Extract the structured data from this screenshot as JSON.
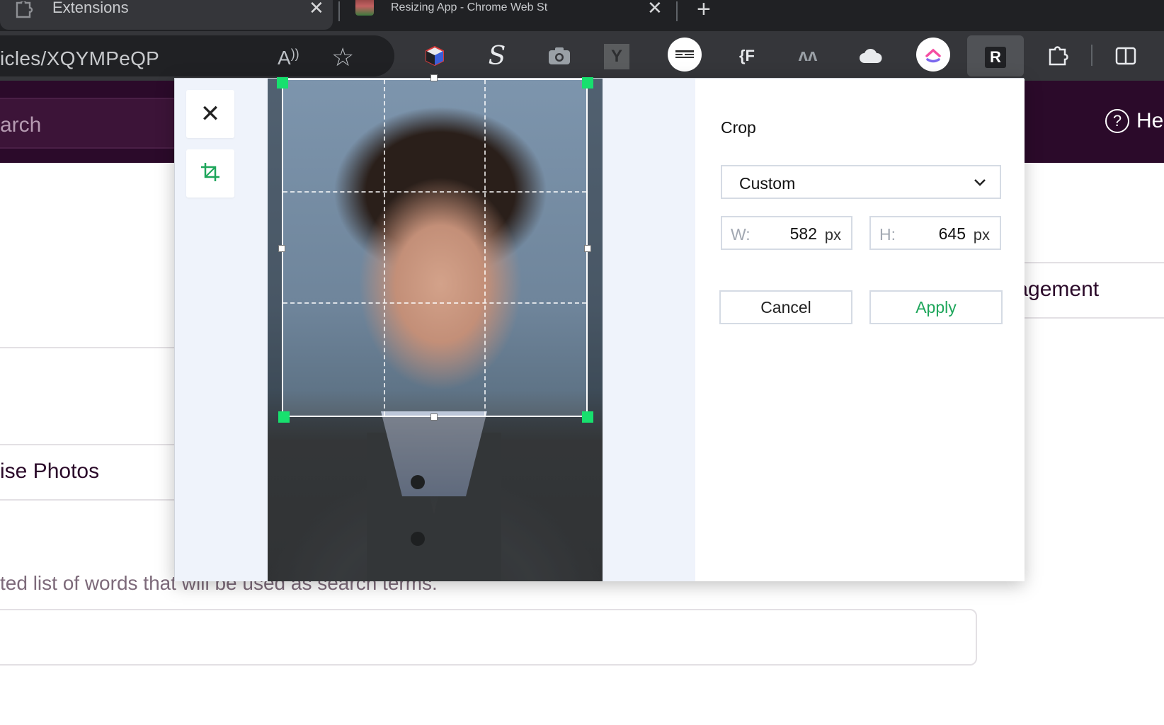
{
  "browser": {
    "tabs": [
      {
        "title": "Extensions",
        "icon": "puzzle-icon"
      },
      {
        "title": "Resizing App - Chrome Web St",
        "icon": "webstore-favicon"
      }
    ],
    "url": "icles/XQYMPeQP",
    "extensions": [
      "cube-icon",
      "s-icon",
      "camera-icon",
      "y-icon",
      "subtitles-icon",
      "f-bracket-icon",
      "m-icon",
      "cloud-icon",
      "clickup-icon",
      "r-icon",
      "puzzle-icon",
      "split-view-icon"
    ],
    "extension_glyphs": {
      "s": "S",
      "f": "{F",
      "m": "ʌʌ",
      "r": "R",
      "y": "Y"
    }
  },
  "page": {
    "search_placeholder": "arch",
    "help_label": "Hel",
    "help_glyph": "?",
    "management_label": "anagement",
    "photos_label": "ise Photos",
    "helper_text": "ted list of words that will be used as search terms."
  },
  "dialog": {
    "close_glyph": "✕",
    "crop": {
      "title": "Crop",
      "preset": "Custom",
      "width_label": "W:",
      "width_value": "582",
      "height_label": "H:",
      "height_value": "645",
      "unit": "px",
      "cancel_label": "Cancel",
      "apply_label": "Apply"
    }
  },
  "colors": {
    "accent": "#17e06e",
    "apply_text": "#1ea65b",
    "header_bg": "#2b0a2a"
  }
}
